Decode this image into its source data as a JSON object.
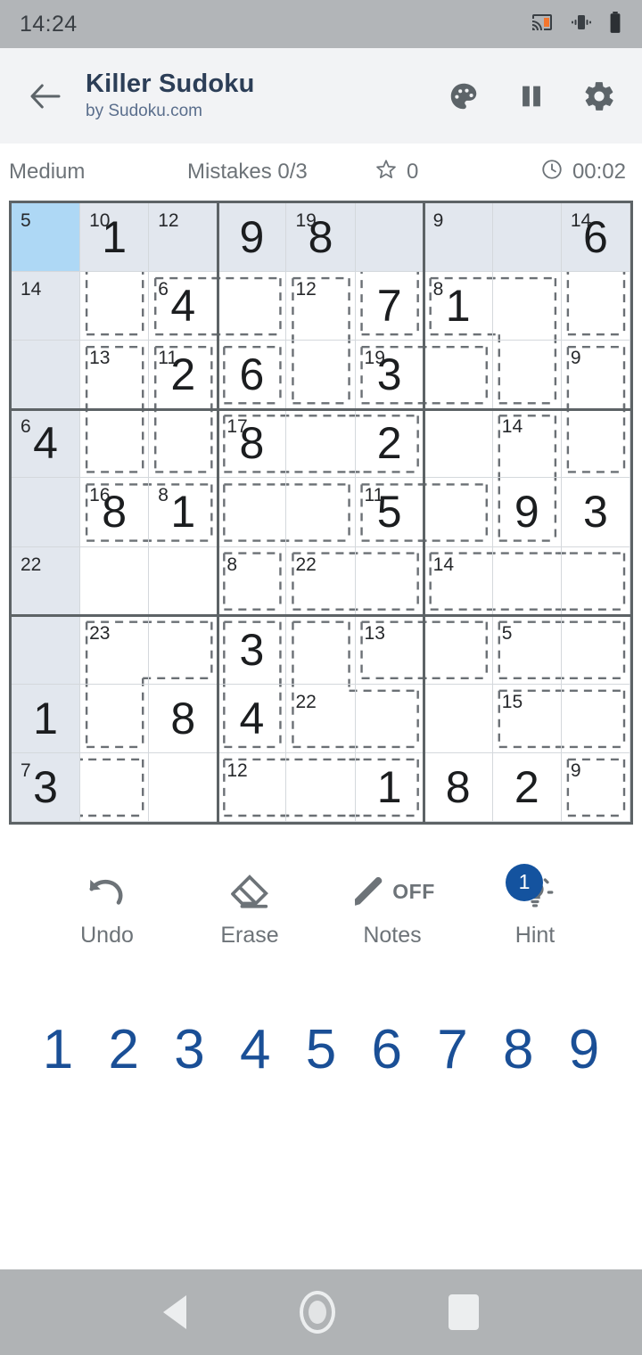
{
  "statusbar": {
    "time": "14:24",
    "icons": [
      "cast-icon",
      "vibrate-icon",
      "battery-icon"
    ]
  },
  "appbar": {
    "back_icon": "back-arrow-icon",
    "title": "Killer Sudoku",
    "subtitle": "by Sudoku.com",
    "actions": [
      {
        "name": "theme-palette-icon",
        "label": "Theme"
      },
      {
        "name": "pause-icon",
        "label": "Pause"
      },
      {
        "name": "settings-gear-icon",
        "label": "Settings"
      }
    ]
  },
  "info": {
    "difficulty": "Medium",
    "mistakes": "Mistakes 0/3",
    "star_icon": "star-outline-icon",
    "score": "0",
    "clock_icon": "clock-icon",
    "timer": "00:02"
  },
  "board": {
    "selected": {
      "row": 0,
      "col": 0
    },
    "highlight_row": 0,
    "highlight_col": 0,
    "colors": {
      "selected": "#aed8f5",
      "highlight": "#e2e7ee",
      "grid_line": "#d4d8dc",
      "box_line": "#5d6366",
      "cage_dash": "#6b7075",
      "value_text": "#1b1d1f"
    },
    "values": [
      [
        "",
        "1",
        "",
        "9",
        "8",
        "",
        "",
        "",
        "6"
      ],
      [
        "",
        "",
        "4",
        "",
        "",
        "7",
        "1",
        "",
        ""
      ],
      [
        "",
        "",
        "2",
        "6",
        "",
        "3",
        "",
        "",
        ""
      ],
      [
        "4",
        "",
        "",
        "8",
        "",
        "2",
        "",
        "",
        ""
      ],
      [
        "",
        "8",
        "1",
        "",
        "",
        "5",
        "",
        "9",
        "3"
      ],
      [
        "",
        "",
        "",
        "",
        "",
        "",
        "",
        "",
        ""
      ],
      [
        "",
        "",
        "",
        "3",
        "",
        "",
        "",
        "",
        ""
      ],
      [
        "1",
        "",
        "8",
        "4",
        "",
        "",
        "",
        "",
        ""
      ],
      [
        "3",
        "",
        "",
        "",
        "",
        "1",
        "8",
        "2",
        ""
      ]
    ],
    "cages": [
      {
        "sum": "5",
        "cells": [
          [
            0,
            0
          ]
        ]
      },
      {
        "sum": "10",
        "cells": [
          [
            0,
            1
          ],
          [
            1,
            1
          ]
        ]
      },
      {
        "sum": "12",
        "cells": [
          [
            0,
            2
          ]
        ]
      },
      {
        "sum": "9",
        "cells": [
          [
            0,
            3
          ]
        ]
      },
      {
        "sum": "19",
        "cells": [
          [
            0,
            4
          ],
          [
            0,
            5
          ],
          [
            1,
            5
          ]
        ]
      },
      {
        "sum": "9",
        "cells": [
          [
            0,
            6
          ],
          [
            0,
            7
          ]
        ]
      },
      {
        "sum": "14",
        "cells": [
          [
            0,
            8
          ],
          [
            1,
            8
          ]
        ]
      },
      {
        "sum": "14",
        "cells": [
          [
            1,
            0
          ],
          [
            2,
            0
          ]
        ]
      },
      {
        "sum": "6",
        "cells": [
          [
            1,
            2
          ],
          [
            1,
            3
          ]
        ]
      },
      {
        "sum": "12",
        "cells": [
          [
            1,
            4
          ],
          [
            2,
            4
          ]
        ]
      },
      {
        "sum": "8",
        "cells": [
          [
            1,
            6
          ],
          [
            1,
            7
          ],
          [
            2,
            7
          ]
        ]
      },
      {
        "sum": "13",
        "cells": [
          [
            2,
            1
          ],
          [
            3,
            1
          ]
        ]
      },
      {
        "sum": "11",
        "cells": [
          [
            2,
            2
          ],
          [
            3,
            2
          ]
        ]
      },
      {
        "sum": "6",
        "cells": [
          [
            2,
            3
          ]
        ]
      },
      {
        "sum": "19",
        "cells": [
          [
            2,
            5
          ],
          [
            2,
            6
          ]
        ]
      },
      {
        "sum": "9",
        "cells": [
          [
            2,
            8
          ],
          [
            3,
            8
          ]
        ]
      },
      {
        "sum": "6",
        "cells": [
          [
            3,
            0
          ],
          [
            4,
            0
          ]
        ]
      },
      {
        "sum": "17",
        "cells": [
          [
            3,
            3
          ],
          [
            3,
            4
          ],
          [
            3,
            5
          ]
        ]
      },
      {
        "sum": "14",
        "cells": [
          [
            3,
            7
          ],
          [
            4,
            7
          ]
        ]
      },
      {
        "sum": "16",
        "cells": [
          [
            4,
            1
          ],
          [
            4,
            2
          ]
        ]
      },
      {
        "sum": "8",
        "cells": [
          [
            4,
            3
          ],
          [
            4,
            4
          ]
        ]
      },
      {
        "sum": "11",
        "cells": [
          [
            4,
            5
          ],
          [
            4,
            6
          ]
        ]
      },
      {
        "sum": "22",
        "cells": [
          [
            5,
            0
          ],
          [
            6,
            0
          ],
          [
            7,
            0
          ]
        ]
      },
      {
        "sum": "8",
        "cells": [
          [
            5,
            3
          ]
        ]
      },
      {
        "sum": "22",
        "cells": [
          [
            5,
            4
          ],
          [
            5,
            5
          ]
        ]
      },
      {
        "sum": "14",
        "cells": [
          [
            5,
            6
          ],
          [
            5,
            7
          ],
          [
            5,
            8
          ]
        ]
      },
      {
        "sum": "23",
        "cells": [
          [
            6,
            1
          ],
          [
            6,
            2
          ],
          [
            7,
            1
          ]
        ]
      },
      {
        "sum": "3",
        "cells": [
          [
            6,
            3
          ],
          [
            7,
            3
          ]
        ]
      },
      {
        "sum": "13",
        "cells": [
          [
            6,
            5
          ],
          [
            6,
            6
          ]
        ]
      },
      {
        "sum": "5",
        "cells": [
          [
            6,
            7
          ],
          [
            6,
            8
          ]
        ]
      },
      {
        "sum": "8",
        "cells": [
          [
            6,
            4
          ],
          [
            7,
            4
          ],
          [
            7,
            5
          ]
        ]
      },
      {
        "sum": "15",
        "cells": [
          [
            7,
            7
          ],
          [
            7,
            8
          ]
        ]
      },
      {
        "sum": "7",
        "cells": [
          [
            8,
            0
          ],
          [
            8,
            1
          ]
        ]
      },
      {
        "sum": "12",
        "cells": [
          [
            8,
            3
          ],
          [
            8,
            4
          ],
          [
            8,
            5
          ]
        ]
      },
      {
        "sum": "9",
        "cells": [
          [
            8,
            8
          ]
        ]
      }
    ],
    "cage_labels": [
      {
        "row": 0,
        "col": 0,
        "sum": "5"
      },
      {
        "row": 0,
        "col": 1,
        "sum": "10"
      },
      {
        "row": 0,
        "col": 2,
        "sum": "12"
      },
      {
        "row": 0,
        "col": 4,
        "sum": "19"
      },
      {
        "row": 0,
        "col": 6,
        "sum": "9"
      },
      {
        "row": 0,
        "col": 8,
        "sum": "14"
      },
      {
        "row": 1,
        "col": 0,
        "sum": "14"
      },
      {
        "row": 1,
        "col": 2,
        "sum": "6"
      },
      {
        "row": 1,
        "col": 4,
        "sum": "12"
      },
      {
        "row": 1,
        "col": 6,
        "sum": "8"
      },
      {
        "row": 2,
        "col": 1,
        "sum": "13"
      },
      {
        "row": 2,
        "col": 2,
        "sum": "11"
      },
      {
        "row": 2,
        "col": 5,
        "sum": "19"
      },
      {
        "row": 2,
        "col": 8,
        "sum": "9"
      },
      {
        "row": 3,
        "col": 0,
        "sum": "6"
      },
      {
        "row": 3,
        "col": 3,
        "sum": "17"
      },
      {
        "row": 3,
        "col": 7,
        "sum": "14"
      },
      {
        "row": 4,
        "col": 1,
        "sum": "16"
      },
      {
        "row": 4,
        "col": 2,
        "sum": "8"
      },
      {
        "row": 4,
        "col": 5,
        "sum": "11"
      },
      {
        "row": 5,
        "col": 0,
        "sum": "22"
      },
      {
        "row": 5,
        "col": 3,
        "sum": "8"
      },
      {
        "row": 5,
        "col": 4,
        "sum": "22"
      },
      {
        "row": 5,
        "col": 6,
        "sum": "14"
      },
      {
        "row": 6,
        "col": 1,
        "sum": "23"
      },
      {
        "row": 6,
        "col": 5,
        "sum": "13"
      },
      {
        "row": 6,
        "col": 7,
        "sum": "5"
      },
      {
        "row": 7,
        "col": 4,
        "sum": "22"
      },
      {
        "row": 7,
        "col": 7,
        "sum": "15"
      },
      {
        "row": 8,
        "col": 0,
        "sum": "7"
      },
      {
        "row": 8,
        "col": 3,
        "sum": "12"
      },
      {
        "row": 8,
        "col": 8,
        "sum": "9"
      }
    ]
  },
  "tools": [
    {
      "name": "undo",
      "icon": "undo-arrow-icon",
      "label": "Undo"
    },
    {
      "name": "erase",
      "icon": "eraser-icon",
      "label": "Erase"
    },
    {
      "name": "notes",
      "icon": "pencil-icon",
      "label": "Notes",
      "state": "OFF"
    },
    {
      "name": "hint",
      "icon": "lightbulb-icon",
      "label": "Hint",
      "badge": "1"
    }
  ],
  "numpad": [
    "1",
    "2",
    "3",
    "4",
    "5",
    "6",
    "7",
    "8",
    "9"
  ],
  "navbar": {
    "back": "nav-back-icon",
    "home": "nav-home-icon",
    "recent": "nav-recent-icon"
  },
  "theme": {
    "accent_blue": "#1a4f96",
    "badge_blue": "#14539f",
    "title_navy": "#2c3e57",
    "muted_gray": "#6d7378",
    "statusbar_gray": "#b2b5b8",
    "navbar_gray": "#b0b3b5",
    "appbar_bg": "#f2f3f5"
  }
}
